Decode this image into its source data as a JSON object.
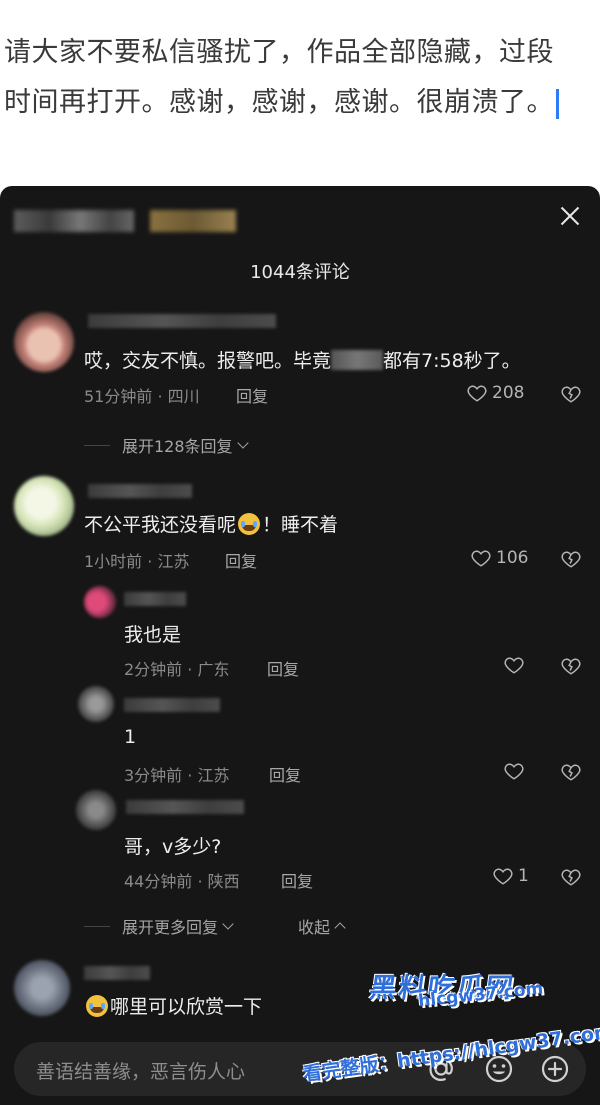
{
  "post": {
    "line1": "请大家不要私信骚扰了，作品全部隐藏，过段",
    "line2": "时间再打开。感谢，感谢，感谢。很崩溃了。"
  },
  "comments_panel": {
    "count_title": "1044条评论",
    "reply_label": "回复",
    "comments": [
      {
        "text_before": "哎，交友不慎。报警吧。毕竟",
        "text_after": "都有7:58秒了。",
        "meta": "51分钟前 · 四川",
        "likes": "208",
        "expand": "展开128条回复"
      },
      {
        "text_before": "不公平我还没看呢",
        "text_after": "！睡不着",
        "meta": "1小时前 · 江苏",
        "likes": "106",
        "replies": [
          {
            "text": "我也是",
            "meta": "2分钟前 · 广东"
          },
          {
            "text": "1",
            "meta": "3分钟前 · 江苏"
          },
          {
            "text": "哥，v多少?",
            "meta": "44分钟前 · 陕西",
            "likes": "1"
          }
        ],
        "expand_more": "展开更多回复",
        "collapse": "收起"
      },
      {
        "text": "哪里可以欣赏一下"
      }
    ],
    "input": {
      "placeholder": "善语结善缘，恶言伤人心"
    }
  },
  "watermark": {
    "logo": "黑料吃瓜网",
    "domain": "hlcgw37.com",
    "label": "看完整版：https://hlcgw37.com"
  },
  "colors": {
    "panel_bg": "#161616",
    "caret": "#2d7bf6",
    "watermark": "#2f6fdc"
  }
}
